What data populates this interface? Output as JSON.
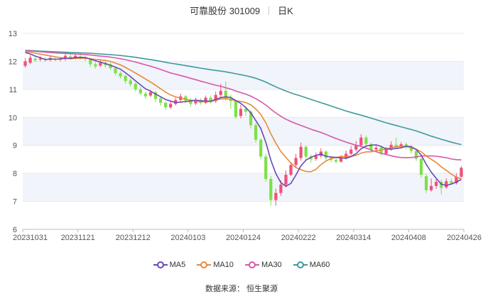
{
  "chart_data": {
    "type": "candlestick",
    "title": {
      "name": "可靠股份 301009",
      "period": "日K"
    },
    "source": "数据来源：  恒生聚源",
    "ylim": [
      6,
      13
    ],
    "yticks": [
      "6",
      "7",
      "8",
      "9",
      "10",
      "11",
      "12",
      "13"
    ],
    "xticks": [
      "20231031",
      "20231121",
      "20231212",
      "20240103",
      "20240124",
      "20240222",
      "20240314",
      "20240408",
      "20240426"
    ],
    "grid": true,
    "legend_position": "bottom",
    "colors": {
      "up": "#f0507a",
      "down": "#7ee04a",
      "MA5": "#6a48b4",
      "MA10": "#e8893a",
      "MA30": "#d658a8",
      "MA60": "#3e9a9e",
      "band": "#f1f4fb",
      "grid": "#e8e8e8"
    },
    "ohlc": [
      [
        11.84,
        12.0,
        12.12,
        11.78
      ],
      [
        11.95,
        12.13,
        12.22,
        11.9
      ],
      [
        12.1,
        12.03,
        12.15,
        11.98
      ],
      [
        12.06,
        12.1,
        12.18,
        12.0
      ],
      [
        12.07,
        12.06,
        12.16,
        11.98
      ],
      [
        12.05,
        12.12,
        12.2,
        12.0
      ],
      [
        12.1,
        12.06,
        12.18,
        12.0
      ],
      [
        12.06,
        12.1,
        12.16,
        12.0
      ],
      [
        12.08,
        12.2,
        12.3,
        12.02
      ],
      [
        12.18,
        12.1,
        12.24,
        12.05
      ],
      [
        12.12,
        12.2,
        12.28,
        12.06
      ],
      [
        12.18,
        12.12,
        12.24,
        12.06
      ],
      [
        12.12,
        12.08,
        12.18,
        12.0
      ],
      [
        12.08,
        11.9,
        12.1,
        11.8
      ],
      [
        11.9,
        11.82,
        11.98,
        11.74
      ],
      [
        11.85,
        11.95,
        12.05,
        11.8
      ],
      [
        11.95,
        11.86,
        12.0,
        11.78
      ],
      [
        11.9,
        11.76,
        11.95,
        11.7
      ],
      [
        11.75,
        11.58,
        11.8,
        11.5
      ],
      [
        11.58,
        11.46,
        11.65,
        11.38
      ],
      [
        11.48,
        11.3,
        11.52,
        11.2
      ],
      [
        11.32,
        11.18,
        11.4,
        11.1
      ],
      [
        11.2,
        11.0,
        11.25,
        10.92
      ],
      [
        11.0,
        10.86,
        11.08,
        10.8
      ],
      [
        10.85,
        10.75,
        10.92,
        10.66
      ],
      [
        10.78,
        10.9,
        10.98,
        10.72
      ],
      [
        10.9,
        10.66,
        10.95,
        10.55
      ],
      [
        10.68,
        10.52,
        10.75,
        10.42
      ],
      [
        10.52,
        10.36,
        10.58,
        10.26
      ],
      [
        10.36,
        10.48,
        10.58,
        10.3
      ],
      [
        10.48,
        10.62,
        10.7,
        10.42
      ],
      [
        10.62,
        10.75,
        10.85,
        10.55
      ],
      [
        10.75,
        10.6,
        10.8,
        10.52
      ],
      [
        10.62,
        10.48,
        10.7,
        10.4
      ],
      [
        10.5,
        10.62,
        10.7,
        10.44
      ],
      [
        10.62,
        10.52,
        10.68,
        10.46
      ],
      [
        10.52,
        10.7,
        10.78,
        10.48
      ],
      [
        10.7,
        10.56,
        10.78,
        10.5
      ],
      [
        10.58,
        10.8,
        10.92,
        10.52
      ],
      [
        10.8,
        10.95,
        11.2,
        10.72
      ],
      [
        10.95,
        10.66,
        11.28,
        10.6
      ],
      [
        10.68,
        10.58,
        10.8,
        10.3
      ],
      [
        10.58,
        10.02,
        10.62,
        9.95
      ],
      [
        10.05,
        10.3,
        10.45,
        9.96
      ],
      [
        10.32,
        10.2,
        10.4,
        10.05
      ],
      [
        10.2,
        9.72,
        10.25,
        9.6
      ],
      [
        9.72,
        9.2,
        9.8,
        9.1
      ],
      [
        9.2,
        8.6,
        9.25,
        8.5
      ],
      [
        8.6,
        7.8,
        8.7,
        7.7
      ],
      [
        7.8,
        7.05,
        7.9,
        6.85
      ],
      [
        7.05,
        7.3,
        7.45,
        6.85
      ],
      [
        7.3,
        7.6,
        7.75,
        7.2
      ],
      [
        7.6,
        7.95,
        8.1,
        7.5
      ],
      [
        7.95,
        8.3,
        8.4,
        7.9
      ],
      [
        8.3,
        8.55,
        8.7,
        8.2
      ],
      [
        8.55,
        8.95,
        9.1,
        8.45
      ],
      [
        8.95,
        8.6,
        9.0,
        8.45
      ],
      [
        8.6,
        8.5,
        8.68,
        8.38
      ],
      [
        8.52,
        8.62,
        8.75,
        8.45
      ],
      [
        8.62,
        8.78,
        8.9,
        8.55
      ],
      [
        8.78,
        8.55,
        8.82,
        8.45
      ],
      [
        8.56,
        8.48,
        8.62,
        8.4
      ],
      [
        8.48,
        8.42,
        8.55,
        8.35
      ],
      [
        8.42,
        8.55,
        8.65,
        8.38
      ],
      [
        8.55,
        8.7,
        8.82,
        8.5
      ],
      [
        8.7,
        8.85,
        8.98,
        8.65
      ],
      [
        8.85,
        9.0,
        9.15,
        8.78
      ],
      [
        9.0,
        9.28,
        9.4,
        8.95
      ],
      [
        9.28,
        9.05,
        9.35,
        8.95
      ],
      [
        9.05,
        8.85,
        9.1,
        8.78
      ],
      [
        8.86,
        8.92,
        9.02,
        8.8
      ],
      [
        8.92,
        8.7,
        8.96,
        8.62
      ],
      [
        8.7,
        8.85,
        8.95,
        8.66
      ],
      [
        8.85,
        9.02,
        9.15,
        8.8
      ],
      [
        9.02,
        8.96,
        9.28,
        8.9
      ],
      [
        8.96,
        9.04,
        9.12,
        8.9
      ],
      [
        9.04,
        8.95,
        9.1,
        8.86
      ],
      [
        8.95,
        8.8,
        9.0,
        8.7
      ],
      [
        8.8,
        8.52,
        8.85,
        8.45
      ],
      [
        8.52,
        7.95,
        8.58,
        7.85
      ],
      [
        7.9,
        7.4,
        7.98,
        7.3
      ],
      [
        7.4,
        7.55,
        7.82,
        7.35
      ],
      [
        7.55,
        7.7,
        7.8,
        7.45
      ],
      [
        7.7,
        7.48,
        7.78,
        7.25
      ],
      [
        7.5,
        7.72,
        7.82,
        7.45
      ],
      [
        7.72,
        7.65,
        7.8,
        7.58
      ],
      [
        7.65,
        7.88,
        8.0,
        7.6
      ],
      [
        7.88,
        8.2,
        8.25,
        7.85
      ]
    ]
  }
}
